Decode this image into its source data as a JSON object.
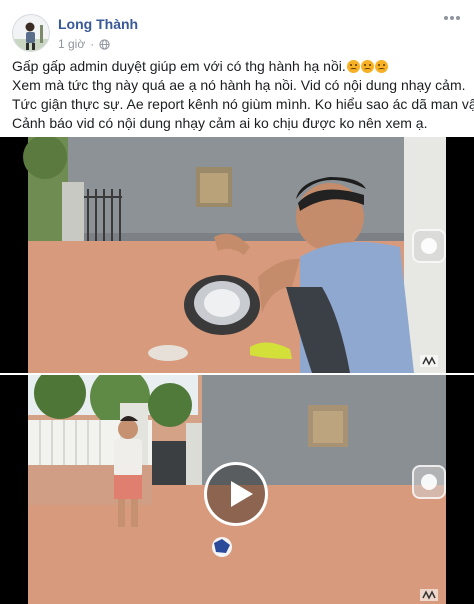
{
  "post": {
    "author": "Long Thành",
    "time": "1 giờ",
    "lines": [
      "Gấp gấp admin duyệt giúp em với có thg hành hạ nồi.",
      "Xem mà tức thg này quá ae ạ nó hành hạ nồi. Vid có nội dung nhạy cảm.",
      "Tức giận thực sự. Ae report kênh nó giùm mình. Ko hiểu sao ác dã man vậy",
      "Cảnh báo vid có nội dung nhạy cảm ai ko chịu được ko nên xem ạ."
    ],
    "line1_emojis": [
      "angry-face-icon",
      "angry-face-icon",
      "angry-face-icon"
    ]
  },
  "media": {
    "video1": {
      "kind": "video-frame",
      "content": "man holding pot on courtyard"
    },
    "video2": {
      "kind": "video",
      "content": "boy with football in courtyard"
    }
  },
  "colors": {
    "author_link": "#385898",
    "meta_text": "#90949c",
    "ground": "#d89a7c",
    "wall": "#8a8f93"
  }
}
